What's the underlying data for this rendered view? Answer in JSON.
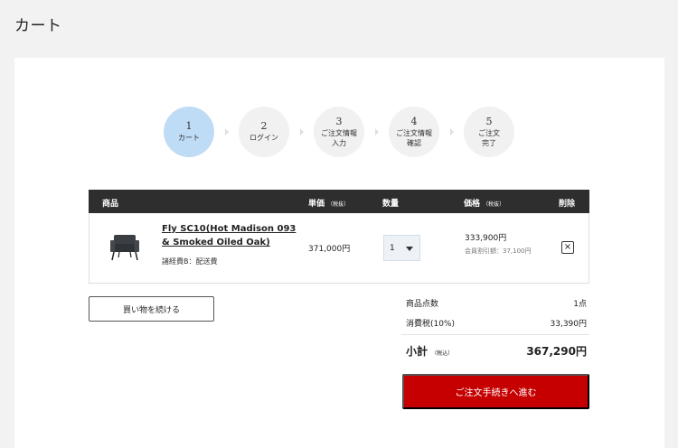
{
  "page": {
    "title": "カート"
  },
  "steps": [
    {
      "num": "1",
      "label": "カート"
    },
    {
      "num": "2",
      "label": "ログイン"
    },
    {
      "num": "3",
      "label": "ご注文情報\n入力"
    },
    {
      "num": "4",
      "label": "ご注文情報\n確認"
    },
    {
      "num": "5",
      "label": "ご注文\n完了"
    }
  ],
  "table": {
    "headers": {
      "product": "商品",
      "unit_price": "単価",
      "unit_price_note": "（税抜）",
      "quantity": "数量",
      "price": "価格",
      "price_note": "（税抜）",
      "delete": "削除"
    },
    "items": [
      {
        "name": "Fly SC10(Hot Madison 093 & Smoked Oiled Oak)",
        "note": "諸経費B：配送費",
        "unit_price": "371,000円",
        "quantity": "1",
        "price": "333,900円",
        "discount": "会員割引額：37,100円",
        "delete_icon": "×"
      }
    ]
  },
  "actions": {
    "continue_label": "買い物を続ける",
    "checkout_label": "ご注文手続きへ進む"
  },
  "summary": {
    "count_label": "商品点数",
    "count_value": "1点",
    "tax_label": "消費税(10%)",
    "tax_value": "33,390円",
    "subtotal_label": "小計",
    "subtotal_note": "（税込）",
    "subtotal_value": "367,290円"
  },
  "colors": {
    "active_step": "#bfdcf6",
    "header_bg": "#2e2e2e",
    "checkout": "#c60000"
  }
}
